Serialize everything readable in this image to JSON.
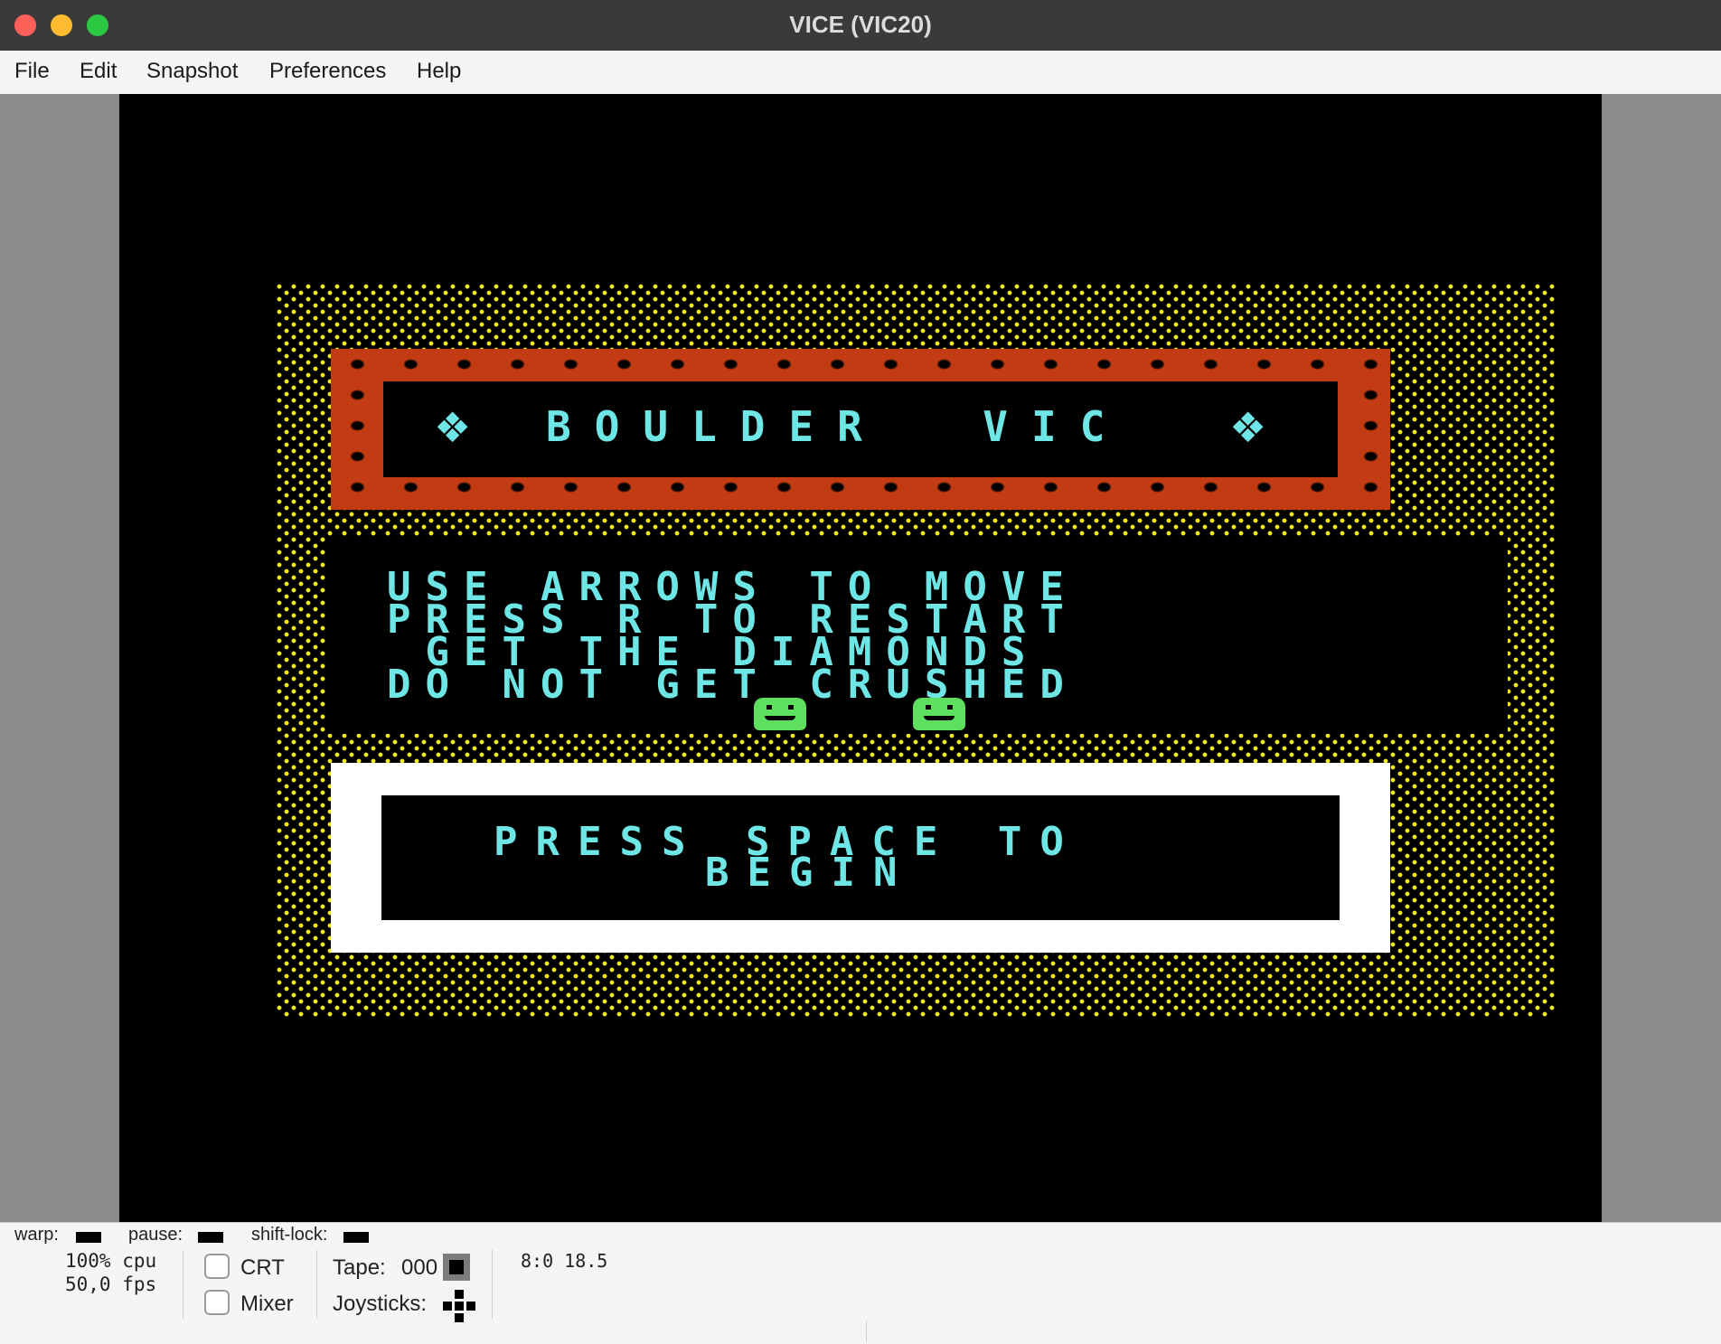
{
  "window": {
    "title": "VICE (VIC20)"
  },
  "menu": {
    "items": [
      "File",
      "Edit",
      "Snapshot",
      "Preferences",
      "Help"
    ]
  },
  "game": {
    "title": "BOULDER  VIC",
    "instructions": [
      "USE ARROWS TO MOVE",
      "PRESS R TO RESTART",
      " GET THE DIAMONDS",
      "DO NOT GET CRUSHED"
    ],
    "prompt_line1": "PRESS SPACE TO",
    "prompt_line2": "BEGIN",
    "colors": {
      "dots": "#f3e81a",
      "brick": "#c23b13",
      "text": "#6ee6e6",
      "face": "#5ee05e"
    }
  },
  "status": {
    "warp_label": "warp:",
    "pause_label": "pause:",
    "shiftlock_label": "shift-lock:",
    "cpu": "100% cpu",
    "fps": "50,0 fps",
    "crt_label": "CRT",
    "mixer_label": "Mixer",
    "tape_label": "Tape:",
    "tape_counter": "000",
    "joysticks_label": "Joysticks:",
    "position": "8:0 18.5"
  }
}
